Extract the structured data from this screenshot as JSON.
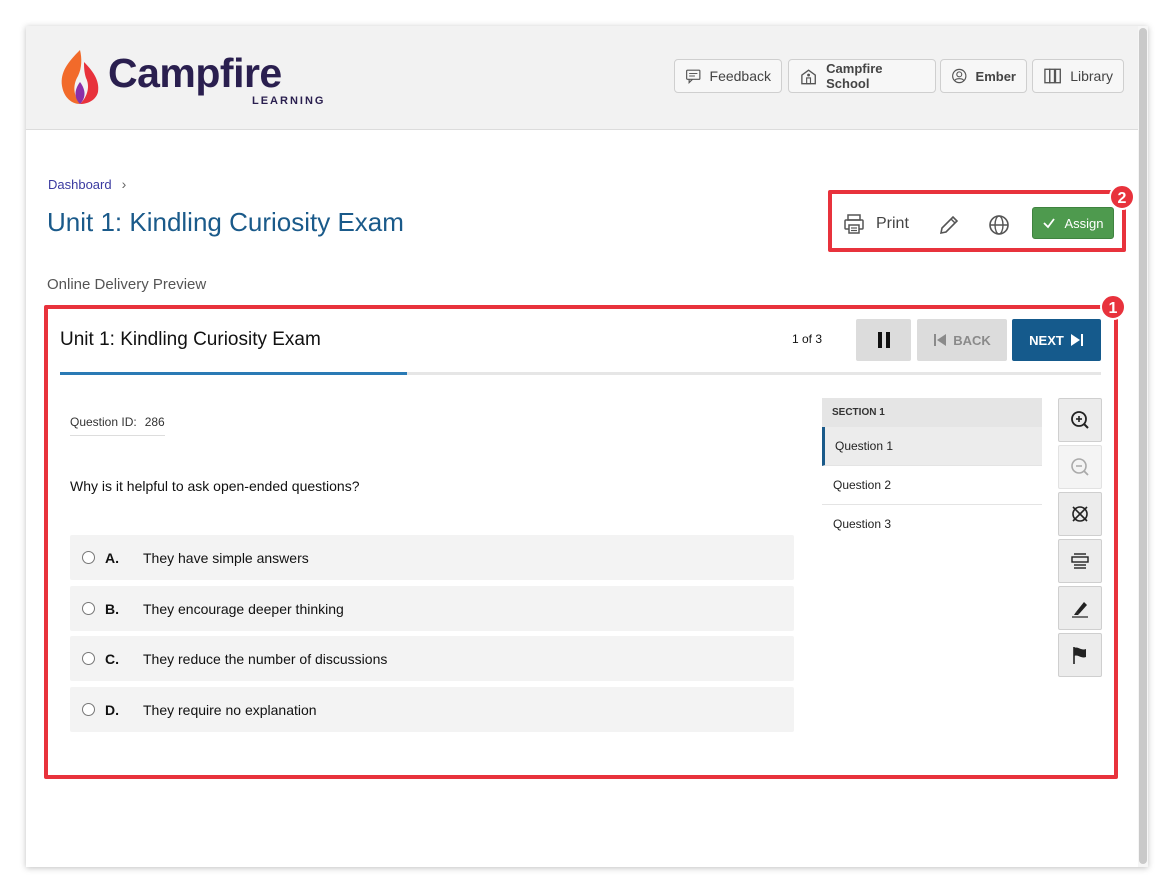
{
  "header": {
    "logo": {
      "word": "Campfire",
      "sub": "LEARNING"
    },
    "buttons": [
      {
        "label": "Feedback",
        "icon": "feedback-icon"
      },
      {
        "label": "Campfire School",
        "icon": "school-icon"
      },
      {
        "label": "Ember",
        "icon": "user-icon"
      },
      {
        "label": "Library",
        "icon": "library-icon"
      }
    ]
  },
  "breadcrumb": {
    "item": "Dashboard"
  },
  "page_title": "Unit 1: Kindling Curiosity Exam",
  "actions": {
    "print_label": "Print",
    "assign_label": "Assign",
    "edit_icon": "pencil-icon",
    "language_icon": "globe-icon"
  },
  "preview_label": "Online Delivery Preview",
  "annotations": {
    "exam_badge": "1",
    "actions_badge": "2",
    "color": "#e8323c"
  },
  "exam": {
    "title": "Unit 1: Kindling Curiosity Exam",
    "progress_text": "1 of 3",
    "progress_fraction": 0.333,
    "back_label": "BACK",
    "next_label": "NEXT",
    "question_id_label": "Question ID:",
    "question_id": "286",
    "question": "Why is it helpful to ask open-ended questions?",
    "options": [
      {
        "letter": "A.",
        "text": "They have simple answers"
      },
      {
        "letter": "B.",
        "text": "They encourage deeper thinking"
      },
      {
        "letter": "C.",
        "text": "They reduce the number of discussions"
      },
      {
        "letter": "D.",
        "text": "They require no explanation"
      }
    ]
  },
  "nav": {
    "section": "SECTION 1",
    "items": [
      "Question 1",
      "Question 2",
      "Question 3"
    ],
    "active_index": 0
  },
  "tools": [
    "zoom-in-icon",
    "zoom-out-icon",
    "eliminate-icon",
    "line-reader-icon",
    "highlighter-icon",
    "flag-icon"
  ],
  "colors": {
    "title_blue": "#1a5a8a",
    "next_blue": "#155a8c",
    "assign_green": "#4e9a4e",
    "logo_navy": "#2a1f4f"
  }
}
